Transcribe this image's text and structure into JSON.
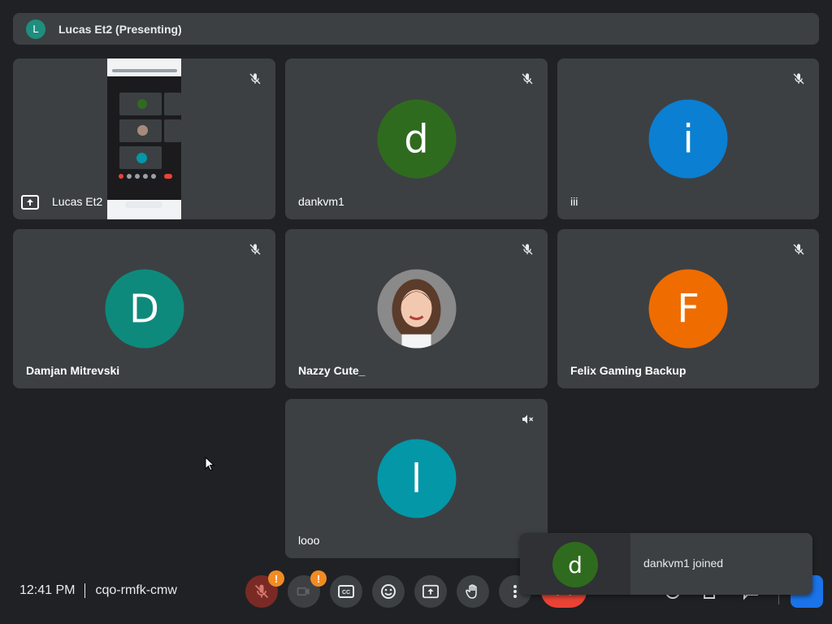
{
  "presenting_bar": {
    "avatar_letter": "L",
    "text": "Lucas Et2 (Presenting)"
  },
  "tiles": [
    {
      "name": "Lucas Et2",
      "type": "screen-share",
      "muted": true
    },
    {
      "name": "dankvm1",
      "avatar_letter": "d",
      "avatar_color": "#2f6b1e",
      "muted": true
    },
    {
      "name": "iii",
      "avatar_letter": "i",
      "avatar_color": "#0b7fd1",
      "muted": true
    },
    {
      "name": "Damjan Mitrevski",
      "avatar_letter": "D",
      "avatar_color": "#0e8a7c",
      "muted": true
    },
    {
      "name": "Nazzy Cute_",
      "avatar_type": "photo",
      "muted": true
    },
    {
      "name": "Felix Gaming Backup",
      "avatar_letter": "F",
      "avatar_color": "#ef6c00",
      "muted": true
    },
    {
      "name": "looo",
      "avatar_letter": "l",
      "avatar_color": "#0397a7",
      "muted": true,
      "speaker_off": true
    }
  ],
  "meeting": {
    "time": "12:41 PM",
    "code": "cqo-rmfk-cmw"
  },
  "controls": [
    {
      "name": "microphone-toggle",
      "icon": "mic-off-icon",
      "badge": "!"
    },
    {
      "name": "camera-toggle",
      "icon": "camera-off-icon",
      "badge": "!"
    },
    {
      "name": "captions",
      "icon": "closed-captions-icon"
    },
    {
      "name": "reactions",
      "icon": "emoji-icon"
    },
    {
      "name": "present",
      "icon": "present-screen-icon"
    },
    {
      "name": "raise-hand",
      "icon": "hand-icon"
    },
    {
      "name": "more-options",
      "icon": "more-vert-icon"
    },
    {
      "name": "leave-call",
      "icon": "end-call-icon"
    }
  ],
  "toast": {
    "avatar_letter": "d",
    "message": "dankvm1 joined"
  },
  "colors": {
    "background": "#202124",
    "tile": "#3c4043",
    "badge": "#f28b24",
    "end_call": "#ea4335",
    "accent": "#1a73e8"
  }
}
